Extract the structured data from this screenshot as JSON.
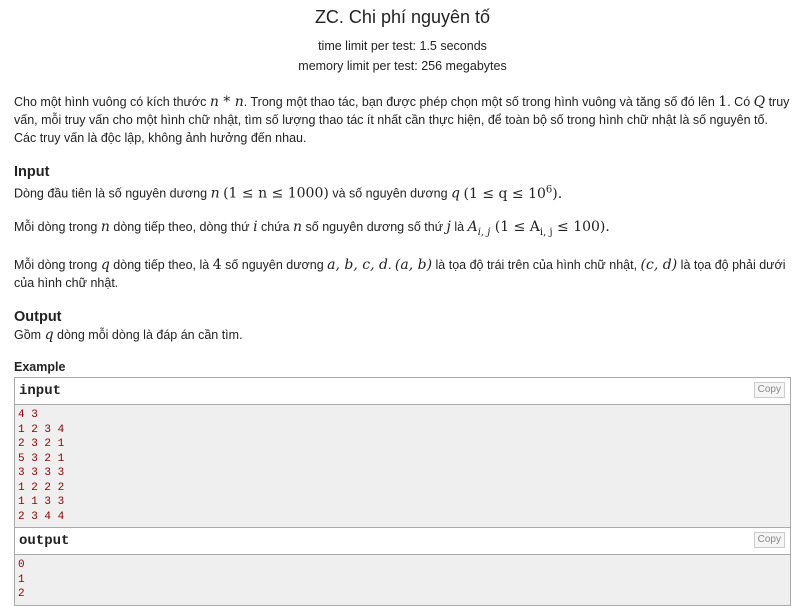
{
  "problem": {
    "title": "ZC. Chi phí nguyên tố",
    "time_limit": "time limit per test: 1.5 seconds",
    "memory_limit": "memory limit per test: 256 megabytes"
  },
  "statement": {
    "p1_a": "Cho một hình vuông có kích thước ",
    "p1_math1": "n * n",
    "p1_b": ". Trong một thao tác, bạn được phép chọn một số trong hình vuông và tăng số đó lên ",
    "p1_math2": "1",
    "p1_c": ". Có ",
    "p1_math3": "Q",
    "p1_d": " truy vấn, mỗi truy vấn cho một hình chữ nhật, tìm số lượng thao tác ít nhất cần thực hiện, để toàn bộ số trong hình chữ nhật là số nguyên tố. Các truy vấn là độc lập, không ảnh hưởng đến nhau."
  },
  "input_section": {
    "title": "Input",
    "l1_a": "Dòng đầu tiên là số nguyên dương ",
    "l1_m1": "n",
    "l1_m2": "(1 ≤ n ≤ 1000)",
    "l1_b": " và số nguyên dương ",
    "l1_m3": "q",
    "l1_m4": "(1 ≤ q ≤ 10",
    "l1_m4_sup": "6",
    "l1_m4_end": ").",
    "l2_a": "Mỗi dòng trong ",
    "l2_m1": "n",
    "l2_b": " dòng tiếp theo, dòng thứ ",
    "l2_m2": "i",
    "l2_c": " chứa ",
    "l2_m3": "n",
    "l2_d": " số nguyên dương số thứ ",
    "l2_m4": "j",
    "l2_e": " là ",
    "l2_m5": "A",
    "l2_m5_sub": "i, j",
    "l2_m6": " (1 ≤ A",
    "l2_m6_sub": "i, j",
    "l2_m6_end": " ≤ 100).",
    "l3_a": "Mỗi dòng trong ",
    "l3_m1": "q",
    "l3_b": " dòng tiếp theo, là ",
    "l3_m2": "4",
    "l3_c": " số nguyên dương ",
    "l3_m3": "a, b, c, d",
    "l3_d": ". ",
    "l3_m4": "(a, b)",
    "l3_e": " là tọa độ trái trên của hình chữ nhật, ",
    "l3_m5": "(c, d)",
    "l3_f": " là tọa độ phải dưới của hình chữ nhật."
  },
  "output_section": {
    "title": "Output",
    "l1_a": "Gồm ",
    "l1_m1": "q",
    "l1_b": " dòng mỗi dòng là đáp án cần tìm."
  },
  "example": {
    "title": "Example",
    "input_label": "input",
    "output_label": "output",
    "copy_label": "Copy",
    "input_lines": [
      "4 3",
      "1 2 3 4",
      "2 3 2 1",
      "5 3 2 1",
      "3 3 3 3",
      "1 2 2 2",
      "1 1 3 3",
      "2 3 4 4"
    ],
    "output_lines": [
      "0",
      "1",
      "2"
    ]
  }
}
